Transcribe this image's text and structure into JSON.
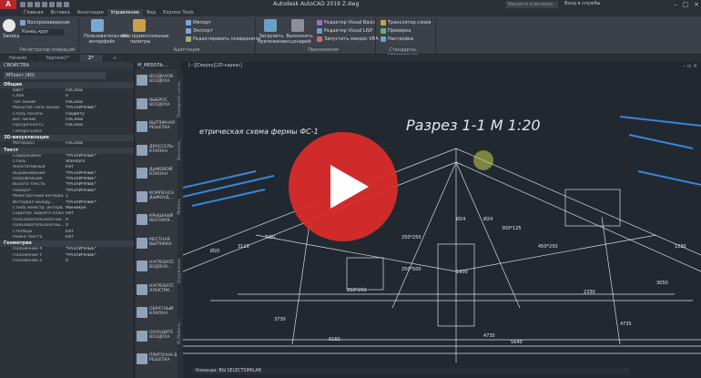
{
  "titlebar": {
    "logo": "A",
    "title": "Autodesk AutoCAD 2019   Z.dwg",
    "search_placeholder": "Введите ключевое слово/фразу",
    "signin": "Вход в службы"
  },
  "ribbon_tabs": [
    "Главная",
    "Вставка",
    "Аннотации",
    "Управление",
    "Вид",
    "Express Tools"
  ],
  "active_ribbon_tab": "Управление",
  "ribbon": {
    "record_label": "Запись",
    "playback_label": "Воспроизведение",
    "combo_value": "Конец круг",
    "macros_panel": "Регистратор операций",
    "custom_ui": "Пользовательский интерфейс",
    "tool_palettes": "Инструментальные палитры",
    "import": "Импорт",
    "export": "Экспорт",
    "edit_aliases": "Редактировать псевдонимы",
    "adapt_panel": "Адаптация",
    "load_app": "Загрузить приложение",
    "run_script": "Выполнить сценарий",
    "vb_editor": "Редактор Visual Basic",
    "vlisp_editor": "Редактор Visual LISP",
    "run_vba": "Запустить макрос VBA",
    "apps_panel": "Приложения",
    "layer_translator": "Транслятор слоев",
    "check": "Проверка",
    "settings": "Настройка",
    "cad_standards_panel": "Стандарты оформления"
  },
  "file_tabs": [
    "Начало",
    "Чертеж1*",
    "Z*"
  ],
  "properties": {
    "title": "СВОЙСТВА",
    "selection": "МТекст (40)",
    "sections": [
      {
        "title": "Общие",
        "rows": [
          [
            "Цвет",
            "ПоСлою"
          ],
          [
            "Слой",
            "0"
          ],
          [
            "Тип линий",
            "ПоСлою"
          ],
          [
            "Масштаб типа линий",
            "*РАЗЛИЧНЫЕ*"
          ],
          [
            "Стиль печати",
            "ПоЦвету"
          ],
          [
            "Вес линий",
            "ПоСлою"
          ],
          [
            "Прозрачность",
            "ПоСлою"
          ],
          [
            "Гиперссылка",
            ""
          ]
        ]
      },
      {
        "title": "3D-визуализация",
        "rows": [
          [
            "Материал",
            "ПоСлою"
          ]
        ]
      },
      {
        "title": "Текст",
        "rows": [
          [
            "Содержимое",
            "*РАЗЛИЧНЫЕ*"
          ],
          [
            "Стиль",
            "Standard"
          ],
          [
            "Аннотативный",
            "Нет"
          ],
          [
            "Выравнивание",
            "*РАЗЛИЧНЫЕ*"
          ],
          [
            "Направление",
            "*РАЗЛИЧНЫЕ*"
          ],
          [
            "Высота текста",
            "*РАЗЛИЧНЫЕ*"
          ],
          [
            "Поворот",
            "*РАЗЛИЧНЫЕ*"
          ],
          [
            "Межстрочный интервал",
            "1"
          ],
          [
            "Интервал между...",
            "*РАЗЛИЧНЫЕ*"
          ],
          [
            "Стиль межстр. интерв...",
            "Минимум"
          ],
          [
            "Скрытие заднего плана",
            "Нет"
          ],
          [
            "Пользовательская ши...",
            "0"
          ],
          [
            "Пользовательская вы...",
            "0"
          ],
          [
            "Столбцы",
            "Нет"
          ],
          [
            "Рамка текста",
            "Нет"
          ]
        ]
      },
      {
        "title": "Геометрия",
        "rows": [
          [
            "Положение X",
            "*РАЗЛИЧНЫЕ*"
          ],
          [
            "Положение Y",
            "*РАЗЛИЧНЫЕ*"
          ],
          [
            "Положение Z",
            "0"
          ]
        ]
      }
    ]
  },
  "palette": {
    "title": "М_МЕБЕЛЬ...",
    "items": [
      "ВОЗДУХОВ ВОЗДУХА",
      "ВЫБРОС ВОЗДУХА",
      "ВЫТЯЖНАЯ РЕШЕТКА",
      "ДРОССЕЛЬ-КЛАПАН",
      "ДЫМОВОЙ КЛАПАН",
      "КОМПЕНСА ДЫМОУД...",
      "КРЫШНЫЙ ВЕНТИЛЯ...",
      "МЕСТНАЯ ВЫТЯЖКА",
      "НАГРЕВАТЕ ВОДЯНО...",
      "НАГРЕВАТЕ ЭЛЕКТРИ...",
      "ОБРАТНЫЙ КЛАПАН",
      "ОХЛАДИТЕ ВОЗДУХА",
      "ПРИТОЧНА В РЕШЕТКА"
    ],
    "side_tabs": [
      "Пожарная сигна...",
      "Вентиля...",
      "Мебель",
      "Окружение",
      "М_Мебель..."
    ]
  },
  "viewport": {
    "label": "[−][Сверху][2D-каркас]",
    "heading": "Разрез 1-1 М 1:20",
    "subheading": "етрическая схема фермы ФС-1",
    "dims": [
      "3110",
      "7/20",
      "250*250",
      "250*500",
      "1900",
      "4735",
      "5640",
      "6160",
      "250*250",
      "300*125",
      "450*250",
      "Ø24",
      "Ø20",
      "Ø24",
      "3730",
      "2330",
      "4735",
      "3050",
      "1230"
    ],
    "command": "Команда: ВЫ SELECTSIMILAR"
  },
  "video_overlay": {
    "accent": "#d92b2b"
  }
}
